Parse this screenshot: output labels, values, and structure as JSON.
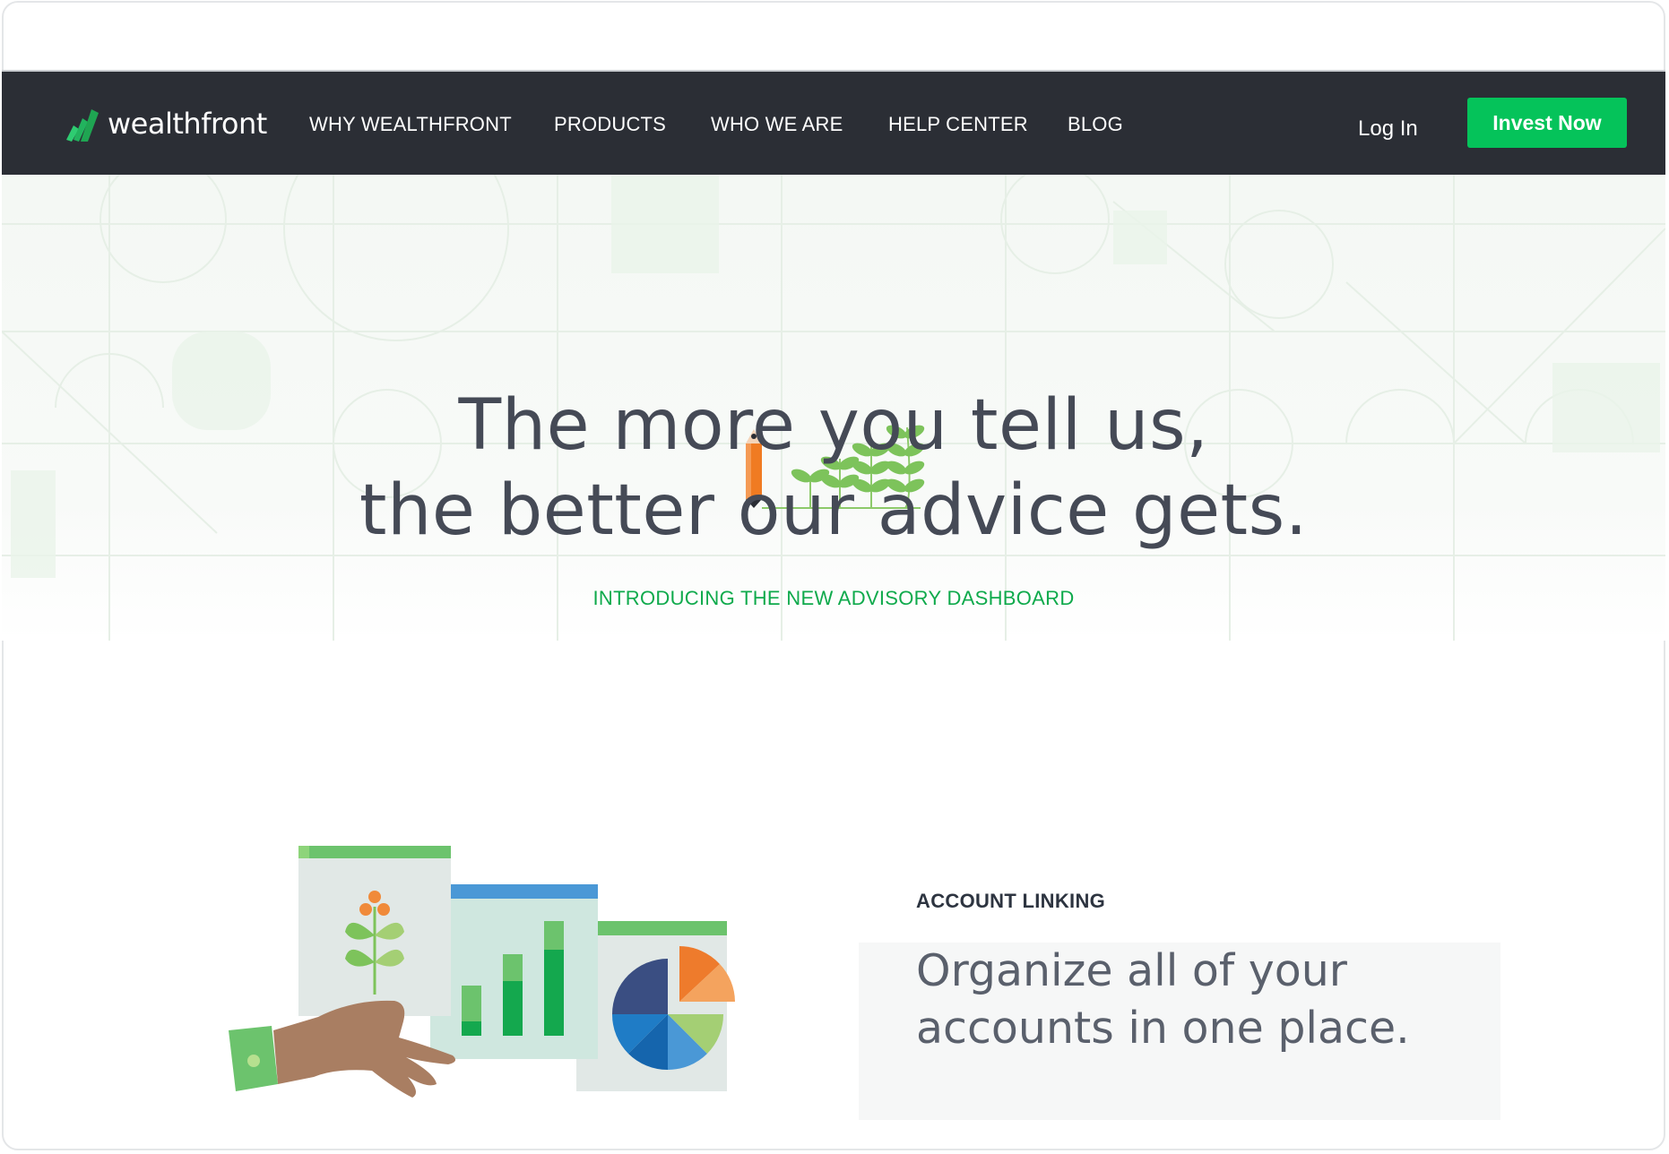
{
  "brand": {
    "name": "wealthfront"
  },
  "nav": {
    "links": [
      "WHY WEALTHFRONT",
      "PRODUCTS",
      "WHO WE ARE",
      "HELP CENTER",
      "BLOG"
    ],
    "login": "Log In",
    "cta": "Invest Now"
  },
  "hero": {
    "line1": "The more you tell us,",
    "line2": "the better our advice gets.",
    "intro": "INTRODUCING THE NEW ADVISORY DASHBOARD"
  },
  "feature": {
    "label": "ACCOUNT LINKING",
    "title_line1": "Organize all of your",
    "title_line2": "accounts in one place."
  },
  "colors": {
    "nav_bg": "#2b2e35",
    "accent": "#05c35a",
    "intro_text": "#0faa4c",
    "headline": "#454a56"
  },
  "icons": [
    "wealthfront-logo-icon",
    "pencil-sprouts-icon",
    "dashboard-illustration"
  ]
}
